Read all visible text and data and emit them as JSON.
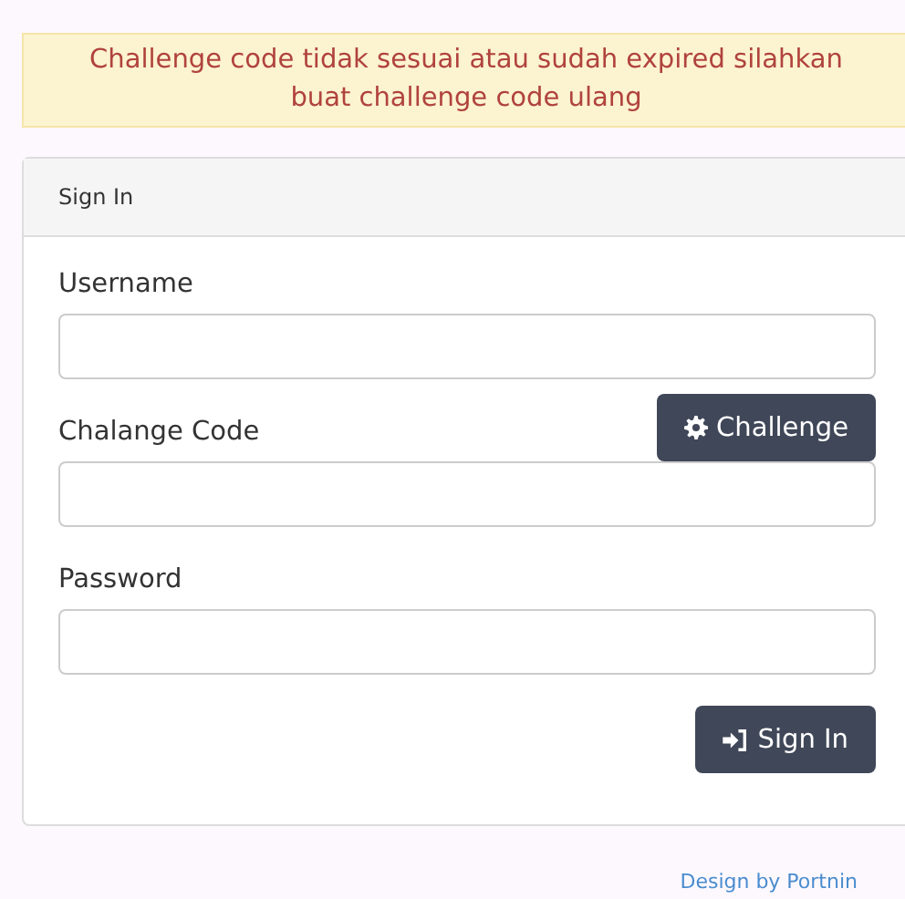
{
  "alert": {
    "message": "Challenge code tidak sesuai atau sudah expired silahkan buat challenge code ulang"
  },
  "panel": {
    "title": "Sign In"
  },
  "fields": [
    {
      "label": "Username",
      "kind": "text"
    },
    {
      "label": "Chalange Code",
      "kind": "challenge",
      "button": "Challenge"
    },
    {
      "label": "Password",
      "kind": "password"
    }
  ],
  "submit": {
    "label": "Sign In"
  },
  "footer": {
    "text": "Design by Portnin"
  }
}
